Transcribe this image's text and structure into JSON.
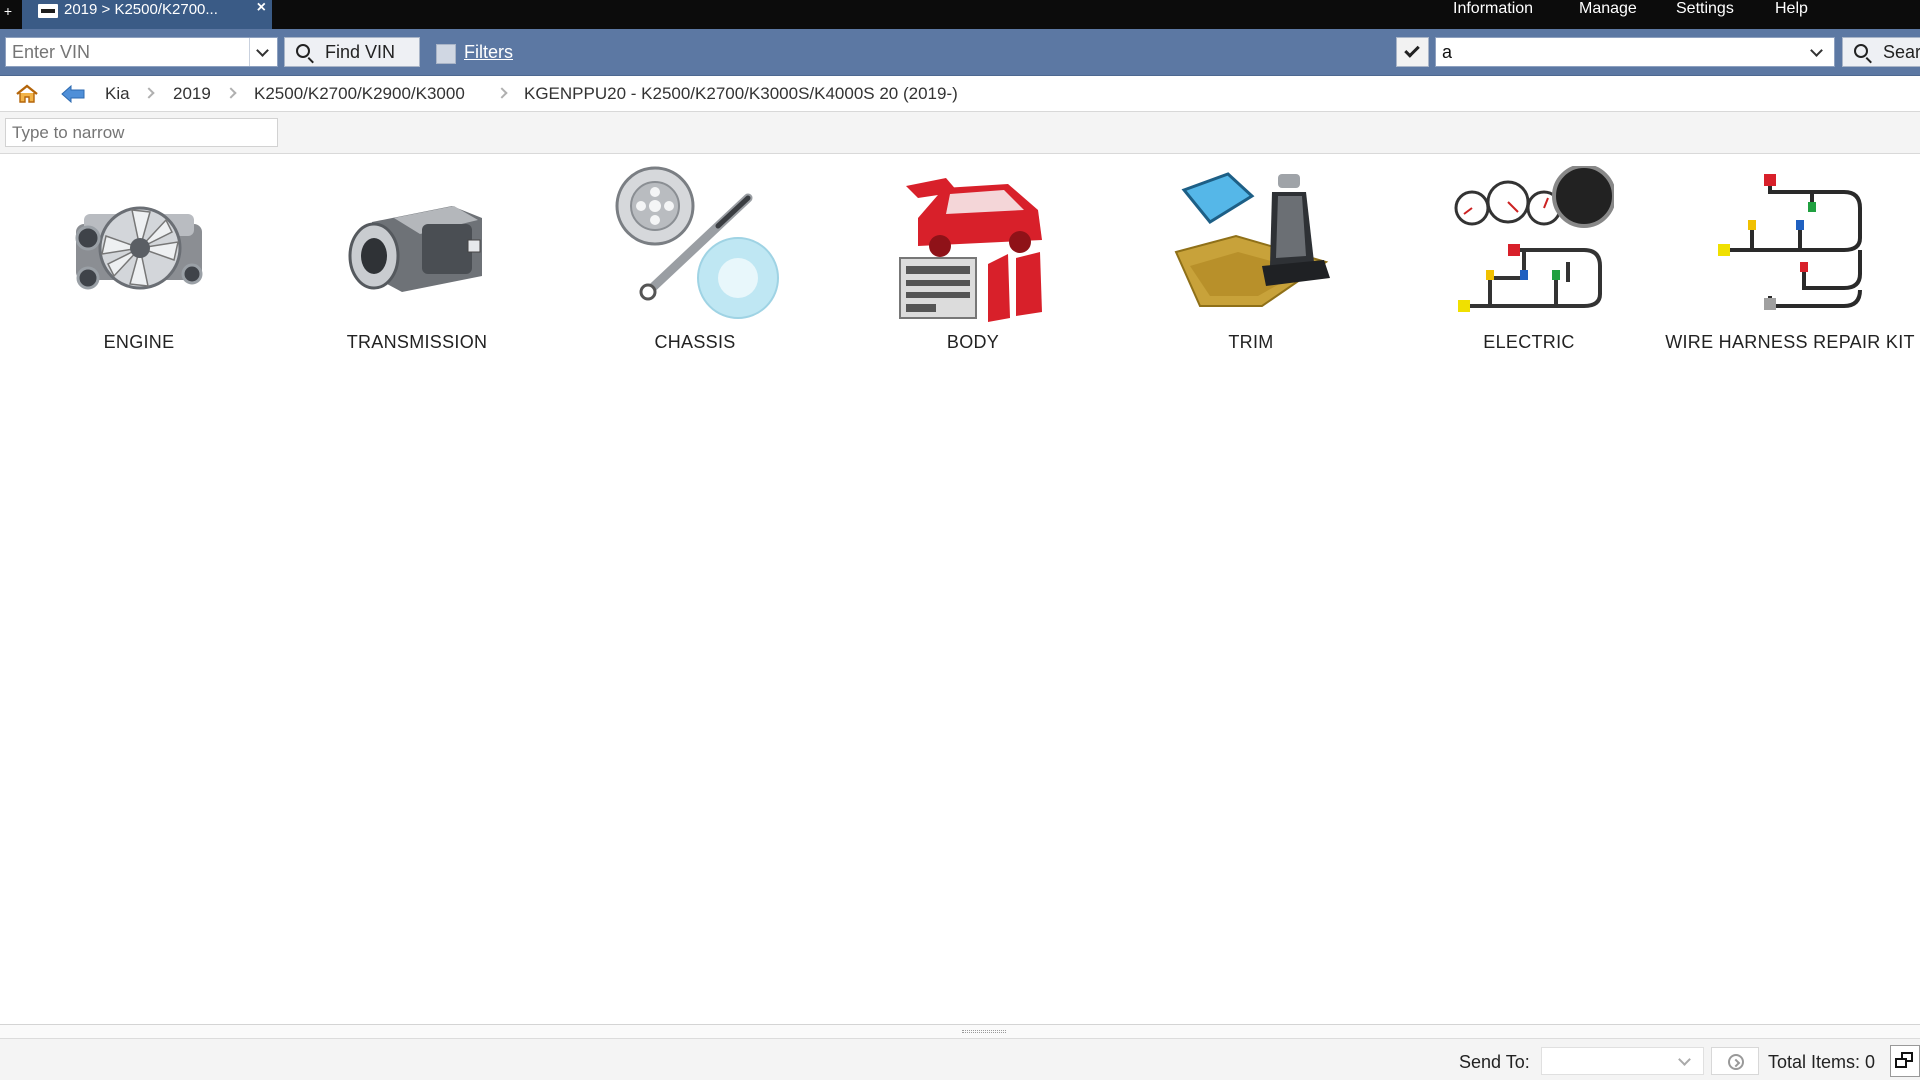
{
  "window": {
    "new_tab_glyph": "+",
    "tab_title": "2019 > K2500/K2700...",
    "tab_close_glyph": "×"
  },
  "menu": {
    "information": "Information",
    "manage": "Manage",
    "settings": "Settings",
    "help": "Help"
  },
  "toolbar": {
    "vin_placeholder": "Enter VIN",
    "find_vin_label": "Find VIN",
    "filters_label": "Filters",
    "search_value": "a",
    "search_label": "Search"
  },
  "breadcrumb": {
    "items": [
      "Kia",
      "2019",
      "K2500/K2700/K2900/K3000",
      "KGENPPU20 - K2500/K2700/K3000S/K4000S 20 (2019-)"
    ]
  },
  "narrow": {
    "placeholder": "Type to narrow"
  },
  "categories": [
    {
      "label": "ENGINE",
      "icon": "engine-icon"
    },
    {
      "label": "TRANSMISSION",
      "icon": "transmission-icon"
    },
    {
      "label": "CHASSIS",
      "icon": "chassis-icon"
    },
    {
      "label": "BODY",
      "icon": "body-icon"
    },
    {
      "label": "TRIM",
      "icon": "trim-icon"
    },
    {
      "label": "ELECTRIC",
      "icon": "electric-icon"
    },
    {
      "label": "WIRE HARNESS REPAIR KIT",
      "icon": "wire-harness-icon"
    }
  ],
  "status": {
    "send_to_label": "Send To:",
    "send_to_value": "",
    "total_items": "Total Items: 0"
  },
  "colors": {
    "toolbar_blue": "#5c78a3",
    "tab_blue": "#3a5b86",
    "body_red": "#d8202a"
  }
}
